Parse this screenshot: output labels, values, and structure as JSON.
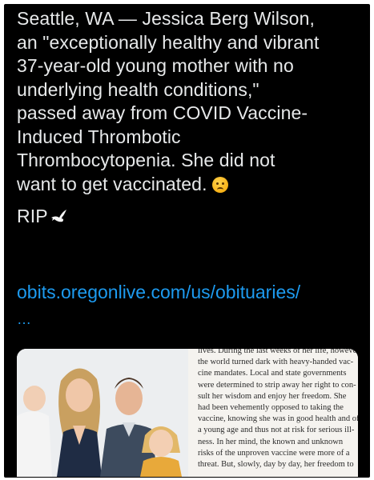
{
  "tweet": {
    "lines": [
      "Seattle, WA — Jessica Berg Wilson,",
      "an \"exceptionally healthy and vibrant",
      "37-year-old young mother with no",
      "underlying health conditions,\"",
      "passed away from COVID Vaccine-",
      "Induced Thrombotic",
      "Thrombocytopenia. She did not",
      "want to get vaccinated."
    ],
    "rip": "RIP",
    "emoji_sad": "sad-face-with-tear-icon",
    "emoji_dove": "dove-icon",
    "link": "obits.oregonlive.com/us/obituaries/",
    "link_ellipsis": "…"
  },
  "media": {
    "article_lines": [
      "lives. During the last weeks of her life, however,",
      "the world turned dark with heavy-handed vac-",
      "cine mandates. Local and state governments",
      "were determined to strip away her right to con-",
      "sult her wisdom and enjoy her freedom. She",
      "had been vehemently opposed to taking the",
      "vaccine, knowing she was in good health and of",
      "a young age and thus not at risk for serious ill-",
      "ness. In her mind, the known and unknown",
      "risks of the unproven vaccine were more of a",
      "threat. But, slowly, day by day, her freedom to"
    ]
  },
  "colors": {
    "background": "#000000",
    "text": "#e7e9ea",
    "link": "#1d9bf0"
  }
}
